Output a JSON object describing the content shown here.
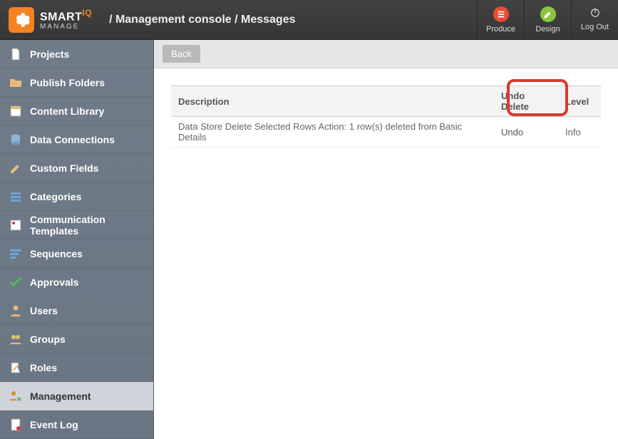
{
  "brand": {
    "name_part1": "SMART",
    "name_part2": "IQ",
    "subtitle": "MANAGE"
  },
  "breadcrumb": "/ Management console / Messages",
  "header_actions": {
    "produce": "Produce",
    "design": "Design",
    "logout": "Log Out"
  },
  "sidebar": {
    "items": [
      {
        "label": "Projects",
        "icon": "file"
      },
      {
        "label": "Publish Folders",
        "icon": "folder"
      },
      {
        "label": "Content Library",
        "icon": "library"
      },
      {
        "label": "Data Connections",
        "icon": "db"
      },
      {
        "label": "Custom Fields",
        "icon": "pencil"
      },
      {
        "label": "Categories",
        "icon": "stack"
      },
      {
        "label": "Communication Templates",
        "icon": "template"
      },
      {
        "label": "Sequences",
        "icon": "sequence"
      },
      {
        "label": "Approvals",
        "icon": "check"
      },
      {
        "label": "Users",
        "icon": "user"
      },
      {
        "label": "Groups",
        "icon": "group"
      },
      {
        "label": "Roles",
        "icon": "roles"
      },
      {
        "label": "Management",
        "icon": "manage",
        "active": true
      },
      {
        "label": "Event Log",
        "icon": "log"
      }
    ]
  },
  "toolbar": {
    "back_label": "Back"
  },
  "table": {
    "columns": {
      "description": "Description",
      "undo": "Undo Delete",
      "level": "Level"
    },
    "rows": [
      {
        "description": "Data Store Delete Selected Rows Action: 1 row(s) deleted from Basic Details",
        "undo": "Undo",
        "level": "Info"
      }
    ]
  }
}
